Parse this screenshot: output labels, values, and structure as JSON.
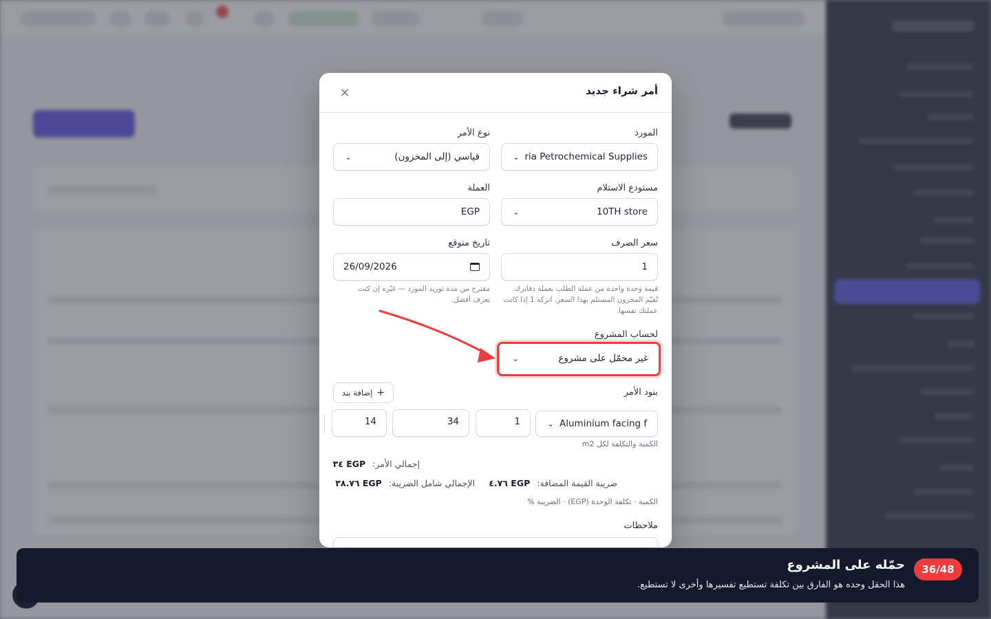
{
  "modal": {
    "title": "أمر شراء جديد",
    "close_icon": "×",
    "supplier": {
      "label": "المورد",
      "value": "Alexandria Petrochemical Supplies"
    },
    "order_type": {
      "label": "نوع الأمر",
      "value": "قياسي (إلى المخزون)"
    },
    "warehouse": {
      "label": "مستودع الاستلام",
      "value": "10TH store"
    },
    "currency": {
      "label": "العملة",
      "value": "EGP"
    },
    "exchange_rate": {
      "label": "سعر الصرف",
      "value": "1",
      "help": "قيمة وحدة واحدة من عملة الطلب بعملة دفاترك. تُقيّم المخزون المستلم بهذا السعر. اتركه 1 إذا كانت عملتك نفسها."
    },
    "expected_date": {
      "label": "تاريخ متوقع",
      "value": "26/09/2026",
      "help": "مقترح من مدة توريد المورد — غيّره إن كنت تعرف أفضل."
    },
    "project": {
      "label": "لحساب المشروع",
      "value": "غير محمّل على مشروع"
    },
    "lines": {
      "label": "بنود الأمر",
      "add_label": "إضافة بند",
      "item": {
        "name": "Aluminium facing foil",
        "quantity": "1",
        "unit_cost": "34",
        "tax_percent": "14"
      },
      "unit_hint": "الكمية والتكلفة لكل m2"
    },
    "totals": {
      "order_total_label": "إجمالي الأمر:",
      "order_total_value": "EGP ٣٤",
      "vat_label": "ضريبة القيمة المضافة:",
      "vat_value": "EGP ٤.٧٦",
      "grand_total_label": "الإجمالي شامل الضريبة:",
      "grand_total_value": "EGP ٣٨.٧٦",
      "columns_hint": "الكمية · تكلفة الوحدة (EGP) · الضريبة %"
    },
    "notes": {
      "label": "ملاحظات"
    }
  },
  "tour": {
    "step": "36/48",
    "title": "حمّله على المشروع",
    "description": "هذا الحقل وحده هو الفارق بين تكلفة تستطيع تفسيرها وأخرى لا تستطيع."
  },
  "colors": {
    "accent": "#ef3b3b",
    "tour_bg": "#141a2c",
    "brand": "#4f46e5"
  },
  "icons": {
    "close": "close-icon",
    "chevron": "chevron-down-icon",
    "calendar": "calendar-icon",
    "plus": "plus-icon"
  }
}
